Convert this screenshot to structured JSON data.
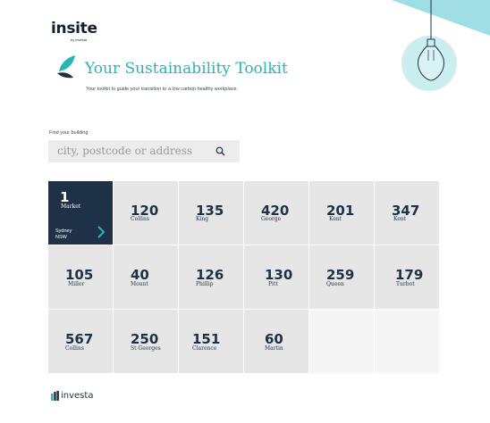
{
  "brand": {
    "logo_text": "insite",
    "logo_sub": "by investa",
    "footer_text": "investa"
  },
  "header": {
    "title": "Your Sustainability Toolkit",
    "subtitle": "Your toolkit to guide your transition to a low carbon healthy workplace."
  },
  "search": {
    "label": "Find your building",
    "placeholder": "city, postcode or address"
  },
  "colors": {
    "accent": "#27b7b2",
    "navy": "#1e3147",
    "tile": "#e6e6e6",
    "bulb_circle": "#cdeef0"
  },
  "buildings": [
    {
      "number": "1",
      "street": "Market",
      "location_line1": "Sydney",
      "location_line2": "NSW",
      "selected": true
    },
    {
      "number": "120",
      "street": "Collins"
    },
    {
      "number": "135",
      "street": "King"
    },
    {
      "number": "420",
      "street": "George"
    },
    {
      "number": "201",
      "street": "Kent"
    },
    {
      "number": "347",
      "street": "Kent"
    },
    {
      "number": "105",
      "street": "Miller"
    },
    {
      "number": "40",
      "street": "Mount"
    },
    {
      "number": "126",
      "street": "Phillip"
    },
    {
      "number": "130",
      "street": "Pitt"
    },
    {
      "number": "259",
      "street": "Queen"
    },
    {
      "number": "179",
      "street": "Turbot"
    },
    {
      "number": "567",
      "street": "Collins"
    },
    {
      "number": "250",
      "street": "St Georges"
    },
    {
      "number": "151",
      "street": "Clarence"
    },
    {
      "number": "60",
      "street": "Martin"
    }
  ]
}
